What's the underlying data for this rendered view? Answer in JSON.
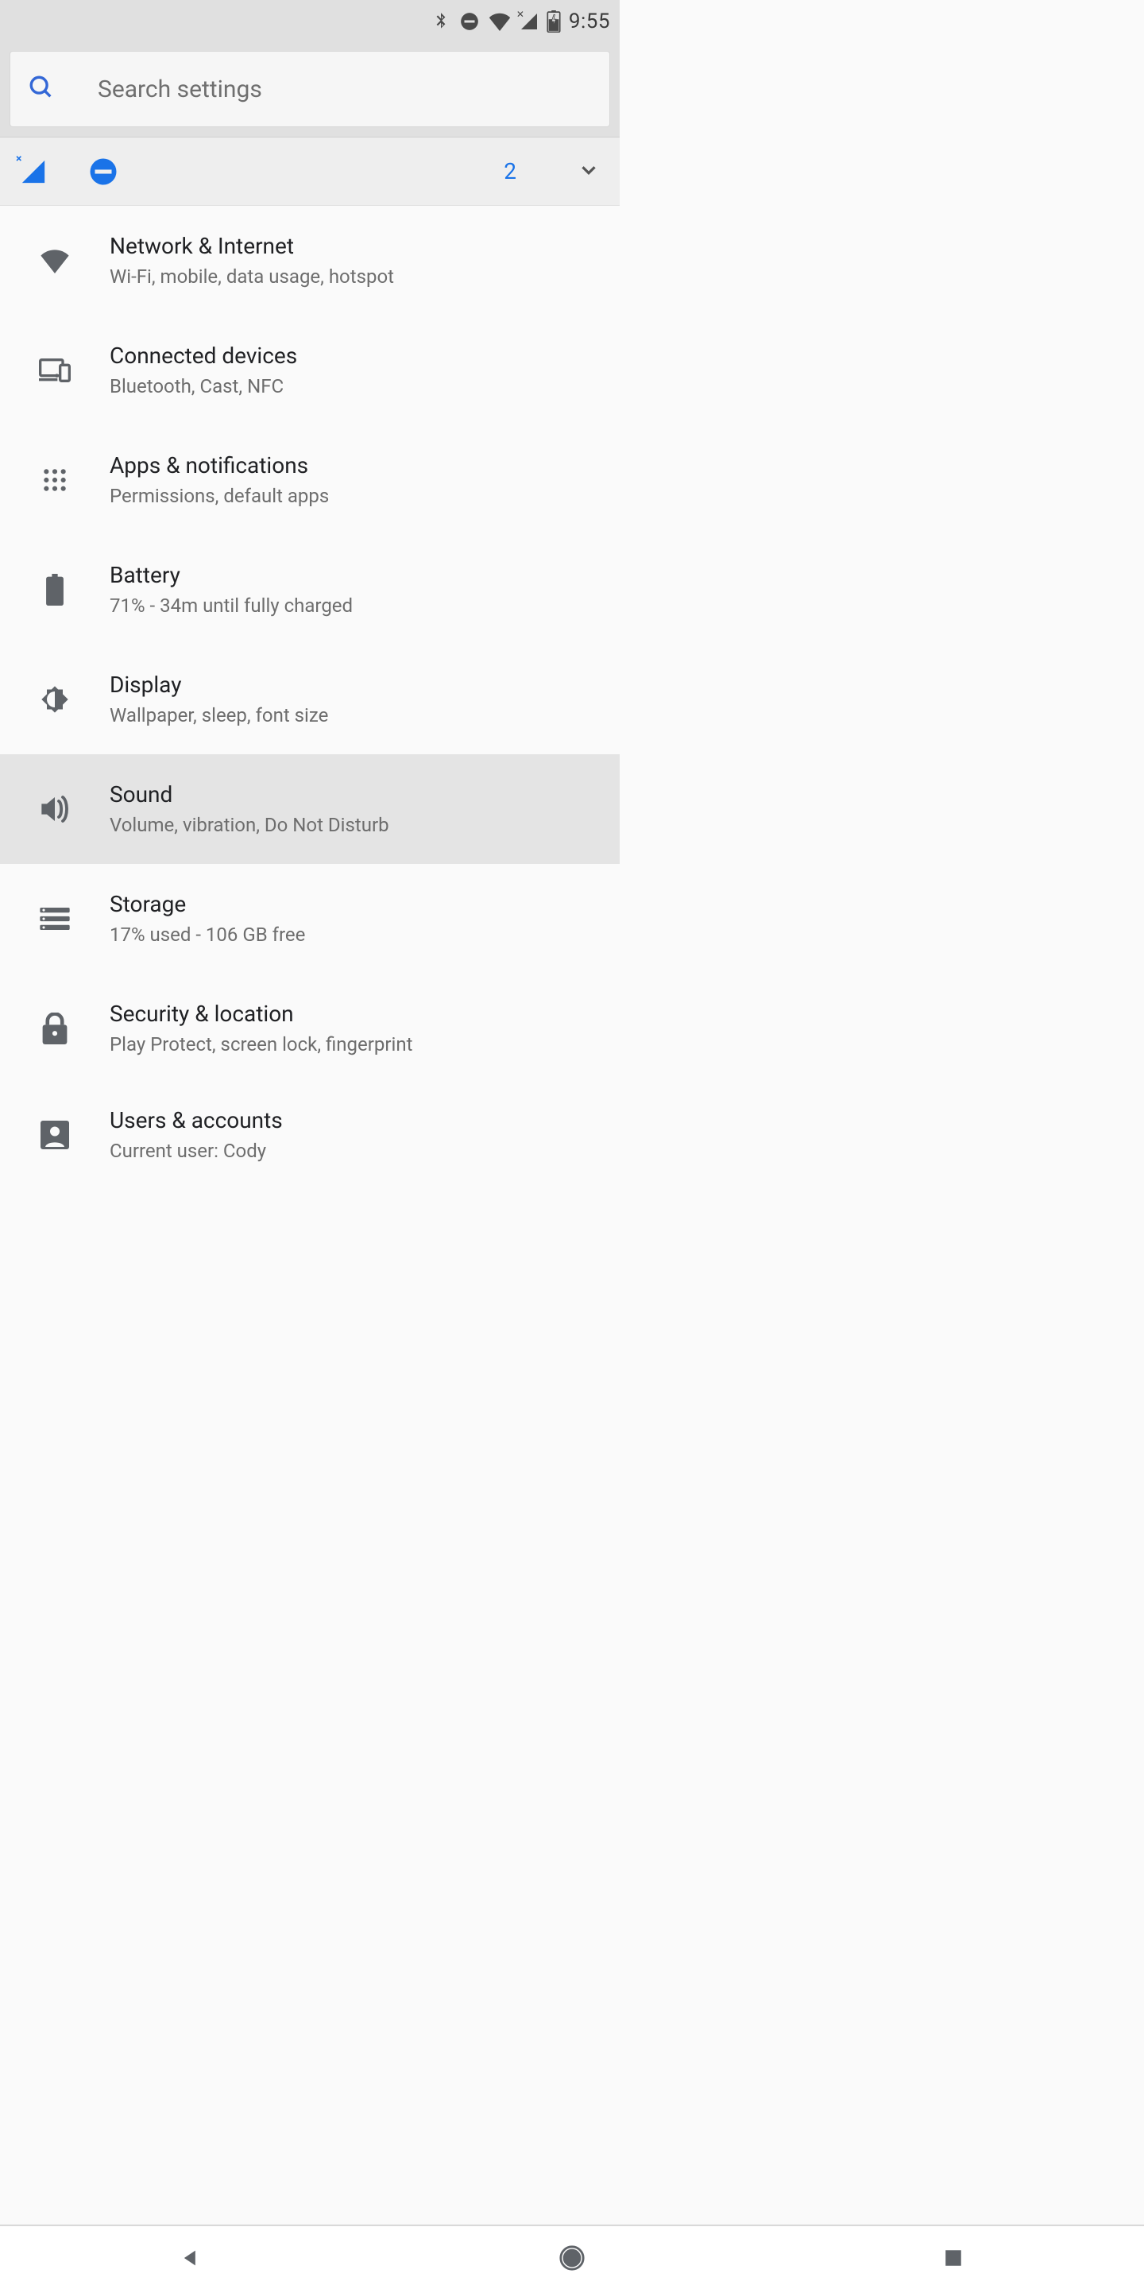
{
  "status_bar": {
    "time": "9:55"
  },
  "search": {
    "placeholder": "Search settings"
  },
  "suggestions": {
    "count": "2"
  },
  "settings": [
    {
      "id": "network",
      "icon": "wifi",
      "title": "Network & Internet",
      "subtitle": "Wi-Fi, mobile, data usage, hotspot"
    },
    {
      "id": "connected",
      "icon": "devices",
      "title": "Connected devices",
      "subtitle": "Bluetooth, Cast, NFC"
    },
    {
      "id": "apps",
      "icon": "apps",
      "title": "Apps & notifications",
      "subtitle": "Permissions, default apps"
    },
    {
      "id": "battery",
      "icon": "battery",
      "title": "Battery",
      "subtitle": "71% - 34m until fully charged"
    },
    {
      "id": "display",
      "icon": "brightness",
      "title": "Display",
      "subtitle": "Wallpaper, sleep, font size"
    },
    {
      "id": "sound",
      "icon": "sound",
      "title": "Sound",
      "subtitle": "Volume, vibration, Do Not Disturb",
      "highlight": true
    },
    {
      "id": "storage",
      "icon": "storage",
      "title": "Storage",
      "subtitle": "17% used - 106 GB free"
    },
    {
      "id": "security",
      "icon": "lock",
      "title": "Security & location",
      "subtitle": "Play Protect, screen lock, fingerprint"
    },
    {
      "id": "users",
      "icon": "account",
      "title": "Users & accounts",
      "subtitle": "Current user: Cody",
      "compact": true
    }
  ]
}
